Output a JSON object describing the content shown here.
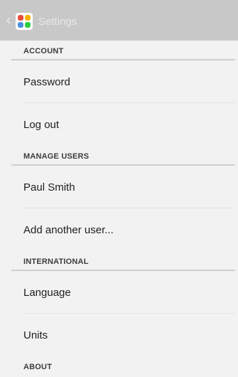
{
  "action_bar": {
    "title": "Settings",
    "icon_name": "settings-app-icon",
    "tile_colors": [
      "#e84c3d",
      "#f5b400",
      "#4a90e2",
      "#2ecc40"
    ]
  },
  "sections": [
    {
      "header": "ACCOUNT",
      "items": [
        {
          "label": "Password"
        },
        {
          "label": "Log out"
        }
      ]
    },
    {
      "header": "MANAGE USERS",
      "items": [
        {
          "label": "Paul Smith"
        },
        {
          "label": "Add another user..."
        }
      ]
    },
    {
      "header": "INTERNATIONAL",
      "items": [
        {
          "label": "Language"
        },
        {
          "label": "Units"
        }
      ]
    },
    {
      "header": "ABOUT",
      "items": []
    }
  ]
}
